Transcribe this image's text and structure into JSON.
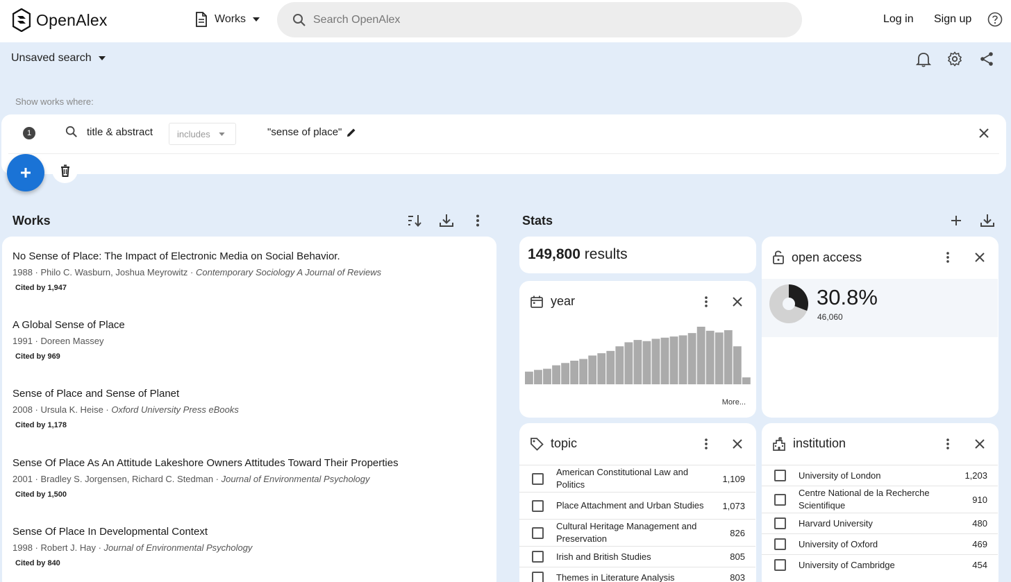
{
  "app": {
    "name": "OpenAlex",
    "entity": "Works",
    "search_placeholder": "Search OpenAlex",
    "login": "Log in",
    "signup": "Sign up"
  },
  "search": {
    "saved_label": "Unsaved search",
    "show_where": "Show works where:",
    "filter": {
      "index": "1",
      "field": "title & abstract",
      "operator": "includes",
      "value": "\"sense of place\""
    }
  },
  "works": {
    "heading": "Works",
    "items": [
      {
        "title": "No Sense of Place: The Impact of Electronic Media on Social Behavior.",
        "year": "1988",
        "authors": "Philo C. Wasburn, Joshua Meyrowitz",
        "venue": "Contemporary Sociology A Journal of Reviews",
        "cited": "Cited by 1,947"
      },
      {
        "title": "A Global Sense of Place",
        "year": "1991",
        "authors": "Doreen Massey",
        "venue": "",
        "cited": "Cited by 969"
      },
      {
        "title": "Sense of Place and Sense of Planet",
        "year": "2008",
        "authors": "Ursula K. Heise",
        "venue": "Oxford University Press eBooks",
        "cited": "Cited by 1,178"
      },
      {
        "title": "Sense Of Place As An Attitude Lakeshore Owners Attitudes Toward Their Properties",
        "year": "2001",
        "authors": "Bradley S. Jorgensen, Richard C. Stedman",
        "venue": "Journal of Environmental Psychology",
        "cited": "Cited by 1,500"
      },
      {
        "title": "Sense Of Place In Developmental Context",
        "year": "1998",
        "authors": "Robert J. Hay",
        "venue": "Journal of Environmental Psychology",
        "cited": "Cited by 840"
      }
    ]
  },
  "stats": {
    "heading": "Stats",
    "results_count": "149,800",
    "results_word": "results",
    "open_access": {
      "label": "open access",
      "percent": "30.8%",
      "fraction": 0.308,
      "count": "46,060"
    },
    "year": {
      "label": "year",
      "more": "More...",
      "bars": [
        0.22,
        0.25,
        0.27,
        0.33,
        0.37,
        0.41,
        0.44,
        0.5,
        0.54,
        0.58,
        0.66,
        0.73,
        0.77,
        0.75,
        0.79,
        0.81,
        0.83,
        0.85,
        0.89,
        1.0,
        0.93,
        0.9,
        0.94,
        0.66,
        0.12
      ]
    },
    "topic": {
      "label": "topic",
      "items": [
        {
          "label": "American Constitutional Law and Politics",
          "count": "1,109"
        },
        {
          "label": "Place Attachment and Urban Studies",
          "count": "1,073"
        },
        {
          "label": "Cultural Heritage Management and Preservation",
          "count": "826"
        },
        {
          "label": "Irish and British Studies",
          "count": "805"
        },
        {
          "label": "Themes in Literature Analysis",
          "count": "803"
        }
      ]
    },
    "institution": {
      "label": "institution",
      "items": [
        {
          "label": "University of London",
          "count": "1,203"
        },
        {
          "label": "Centre National de la Recherche Scientifique",
          "count": "910"
        },
        {
          "label": "Harvard University",
          "count": "480"
        },
        {
          "label": "University of Oxford",
          "count": "469"
        },
        {
          "label": "University of Cambridge",
          "count": "454"
        }
      ]
    }
  },
  "colors": {
    "accent": "#1a73d6",
    "background": "#e3edf9",
    "bar": "#ababab"
  }
}
